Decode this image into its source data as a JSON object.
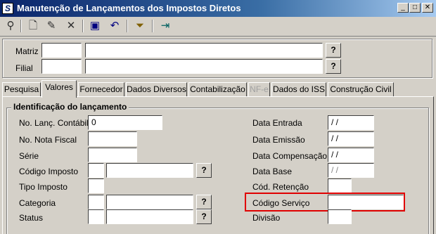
{
  "window": {
    "title": "Manutenção de Lançamentos dos Impostos Diretos",
    "app_icon": "S"
  },
  "header": {
    "matriz_label": "Matriz",
    "filial_label": "Filial",
    "lookup_label": "?"
  },
  "tabs": [
    {
      "label": "Pesquisa"
    },
    {
      "label": "Valores"
    },
    {
      "label": "Fornecedor"
    },
    {
      "label": "Dados Diversos"
    },
    {
      "label": "Contabilização"
    },
    {
      "label": "NF-e"
    },
    {
      "label": "Dados do ISS"
    },
    {
      "label": "Construção Civil"
    }
  ],
  "section": {
    "title": "Identificação do lançamento"
  },
  "left_fields": [
    {
      "label": "No. Lanç. Contábil",
      "value": "0"
    },
    {
      "label": "No. Nota Fiscal",
      "value": ""
    },
    {
      "label": "Série",
      "value": ""
    },
    {
      "label": "Código Imposto",
      "value": ""
    },
    {
      "label": "Tipo Imposto",
      "value": ""
    },
    {
      "label": "Categoria",
      "value": ""
    },
    {
      "label": "Status",
      "value": ""
    }
  ],
  "right_fields": [
    {
      "label": "Data Entrada",
      "value": "/ /"
    },
    {
      "label": "Data Emissão",
      "value": "/ /"
    },
    {
      "label": "Data Compensação",
      "value": "/ /"
    },
    {
      "label": "Data Base",
      "value": "/ /"
    },
    {
      "label": "Cód. Retenção",
      "value": ""
    },
    {
      "label": "Código Serviço",
      "value": ""
    },
    {
      "label": "Divisão",
      "value": ""
    }
  ],
  "highlight_color": "#e00000"
}
